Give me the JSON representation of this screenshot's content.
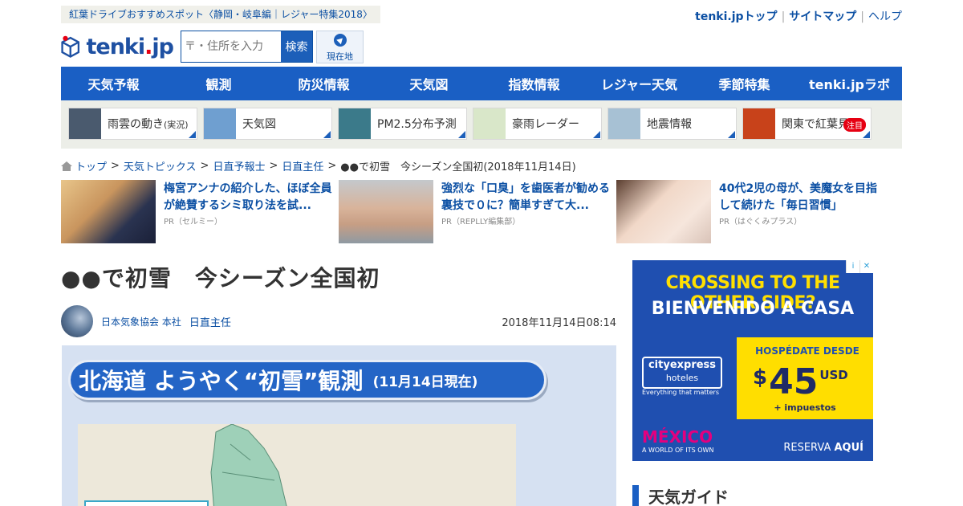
{
  "header": {
    "promo": "紅葉ドライブおすすめスポット〈静岡・岐阜編｜レジャー特集2018〉",
    "links": [
      "tenki.jpトップ",
      "サイトマップ",
      "ヘルプ"
    ],
    "logo": "tenki.jp",
    "search_placeholder": "〒・住所を入力",
    "search_button": "検索",
    "location_button": "現在地"
  },
  "gnav": [
    "天気予報",
    "観測",
    "防災情報",
    "天気図",
    "指数情報",
    "レジャー天気",
    "季節特集",
    "tenki.jpラボ"
  ],
  "subnav": [
    {
      "label": "雨雲の動き",
      "small": "(実況)",
      "color": "#4a5a6e"
    },
    {
      "label": "天気図",
      "small": "",
      "color": "#6f9fd0"
    },
    {
      "label": "PM2.5分布予測",
      "small": "",
      "color": "#3b7a8a"
    },
    {
      "label": "豪雨レーダー",
      "small": "",
      "color": "#d9e7c9"
    },
    {
      "label": "地震情報",
      "small": "",
      "color": "#a7c1d4"
    },
    {
      "label": "関東で紅葉見頃",
      "small": "",
      "badge": "注目",
      "color": "#c8421a"
    }
  ],
  "breadcrumb": [
    "トップ",
    "天気トピックス",
    "日直予報士",
    "日直主任",
    "●●で初雪　今シーズン全国初(2018年11月14日)"
  ],
  "ads": [
    {
      "title": "梅宮アンナの紹介した、ほぼ全員が絶賛するシミ取り法を試...",
      "pr": "PR（セルミー）",
      "color": "#caa57a"
    },
    {
      "title": "強烈な「口臭」を歯医者が勧める裏技で０に？簡単すぎて大...",
      "pr": "PR（REPLLY編集部）",
      "color": "#b0b5b8"
    },
    {
      "title": "40代2児の母が、美魔女を目指して続けた「毎日習慣」",
      "pr": "PR（はぐくみプラス）",
      "color": "#e0c9bd"
    }
  ],
  "article": {
    "title": "●●で初雪　今シーズン全国初",
    "org": "日本気象協会 本社",
    "author": "日直主任",
    "date": "2018年11月14日08:14",
    "figure_title": "北海道 ようやく“初雪”観測",
    "figure_sub": "(11月14日現在)"
  },
  "sidead": {
    "h1": "CROSSING TO THE OTHER SIDE?",
    "h2": "BIENVENIDO A CASA",
    "brand": "cityexpress",
    "brand2": "hoteles",
    "tagline": "Everything that matters",
    "hosp": "HOSPÉDATE DESDE",
    "currency": "$",
    "price": "45",
    "usd": "USD",
    "imp": "+ impuestos",
    "mexico": "MÉXICO",
    "mexico2": "A WORLD OF ITS OWN",
    "reserve": "RESERVA",
    "reserve2": "AQUÍ"
  },
  "sidebar_title": "天気ガイド"
}
